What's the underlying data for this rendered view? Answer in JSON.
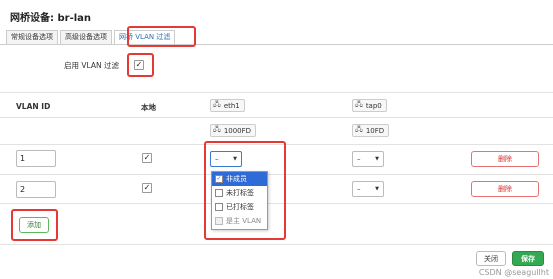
{
  "dialog": {
    "title": "网桥设备: br-lan"
  },
  "tabs": [
    {
      "label": "常规设备选项"
    },
    {
      "label": "高级设备选项"
    },
    {
      "label": "网桥 VLAN 过滤"
    }
  ],
  "vlan_filter": {
    "label": "启用 VLAN 过滤",
    "checked": true
  },
  "table": {
    "headers": {
      "vlan_id": "VLAN ID",
      "local": "本地"
    },
    "ports": [
      {
        "name": "eth1",
        "speed": "1000FD",
        "icon": "ethernet-port-icon"
      },
      {
        "name": "tap0",
        "speed": "10FD",
        "icon": "ethernet-port-icon"
      }
    ],
    "rows": [
      {
        "vlan_id": "1",
        "local": true,
        "eth1": "–",
        "tap0": "–",
        "delete_label": "删除"
      },
      {
        "vlan_id": "2",
        "local": true,
        "eth1": "–",
        "tap0": "–",
        "delete_label": "删除"
      }
    ]
  },
  "dropdown": {
    "options": [
      {
        "label": "非成员",
        "checked": true,
        "selected": true
      },
      {
        "label": "未打标签",
        "checked": false
      },
      {
        "label": "已打标签",
        "checked": false
      },
      {
        "label": "是主 VLAN",
        "checked": false,
        "disabled": true
      }
    ]
  },
  "buttons": {
    "add": "添加",
    "close": "关闭",
    "save": "保存"
  },
  "watermark": "CSDN @seagullht",
  "colors": {
    "highlight": "#e53935",
    "save": "#34a853",
    "accent": "#2f6bd6",
    "delete": "#d32f2f"
  }
}
